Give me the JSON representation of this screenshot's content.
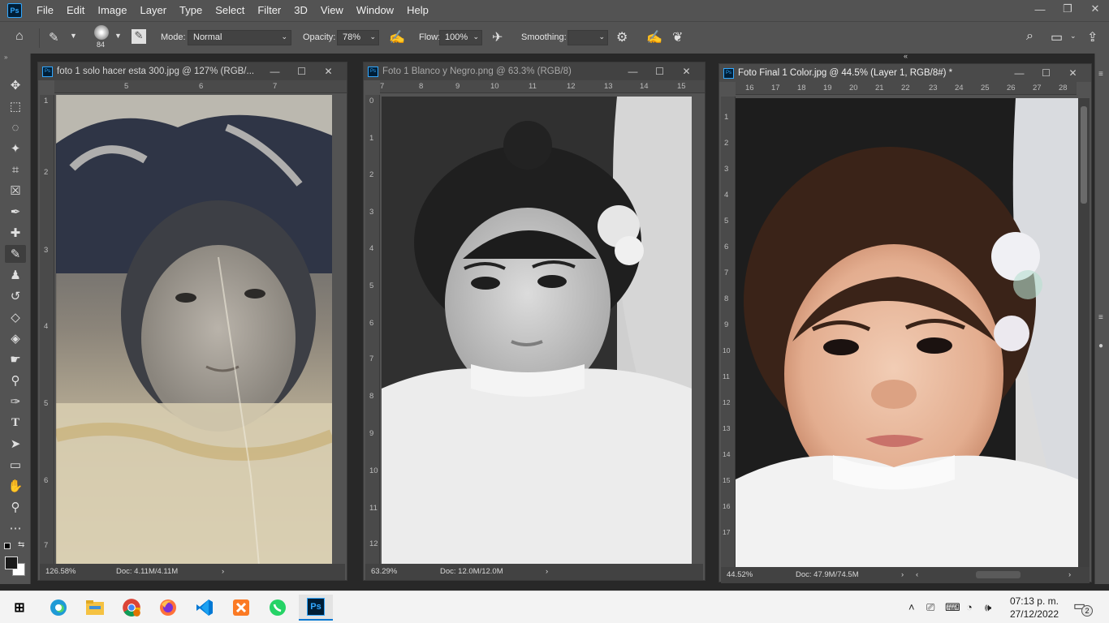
{
  "menubar": {
    "items": [
      "File",
      "Edit",
      "Image",
      "Layer",
      "Type",
      "Select",
      "Filter",
      "3D",
      "View",
      "Window",
      "Help"
    ],
    "logo": "Ps"
  },
  "options": {
    "brush_size": "84",
    "mode_label": "Mode:",
    "mode_value": "Normal",
    "opacity_label": "Opacity:",
    "opacity_value": "78%",
    "flow_label": "Flow:",
    "flow_value": "100%",
    "smoothing_label": "Smoothing:",
    "smoothing_value": ""
  },
  "docs": [
    {
      "title": "foto 1 solo hacer esta 300.jpg @ 127% (RGB/...",
      "zoom": "126.58%",
      "doc_size": "Doc: 4.11M/4.11M",
      "ruler_h": [
        "5",
        "6",
        "7"
      ],
      "ruler_v": [
        "1",
        "2",
        "3",
        "4",
        "5",
        "6",
        "7"
      ]
    },
    {
      "title": "Foto 1 Blanco y Negro.png @ 63.3% (RGB/8)",
      "zoom": "63.29%",
      "doc_size": "Doc: 12.0M/12.0M",
      "ruler_h": [
        "7",
        "8",
        "9",
        "10",
        "11",
        "12",
        "13",
        "14",
        "15"
      ],
      "ruler_v": [
        "0",
        "1",
        "2",
        "3",
        "4",
        "5",
        "6",
        "7",
        "8",
        "9",
        "10",
        "11",
        "12"
      ]
    },
    {
      "title": "Foto Final 1 Color.jpg @ 44.5% (Layer 1, RGB/8#) *",
      "zoom": "44.52%",
      "doc_size": "Doc: 47.9M/74.5M",
      "ruler_h": [
        "16",
        "17",
        "18",
        "19",
        "20",
        "21",
        "22",
        "23",
        "24",
        "25",
        "26",
        "27",
        "28"
      ],
      "ruler_v": [
        "1",
        "2",
        "3",
        "4",
        "5",
        "6",
        "7",
        "8",
        "9",
        "10",
        "11",
        "12",
        "13",
        "14",
        "15",
        "16",
        "17"
      ]
    }
  ],
  "taskbar": {
    "time": "07:13 p. m.",
    "date": "27/12/2022",
    "notifications": "2",
    "apps": [
      "edge",
      "file-explorer",
      "chrome",
      "firefox",
      "vscode",
      "xampp",
      "whatsapp",
      "photoshop"
    ]
  },
  "colors": {
    "ui_dark": "#535353",
    "panel": "#424242",
    "accent": "#31a8ff"
  }
}
